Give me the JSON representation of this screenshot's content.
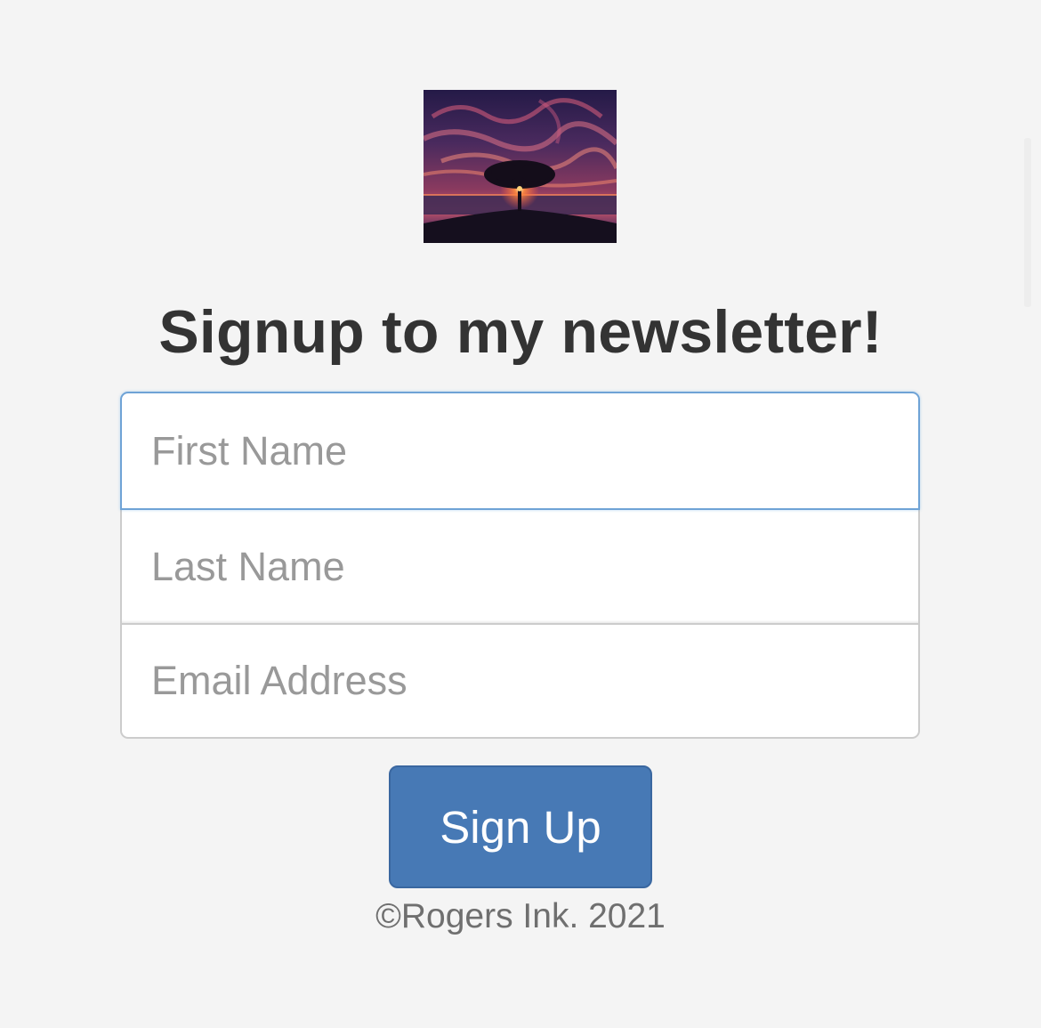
{
  "logo": {
    "alt": "Tree at sunset"
  },
  "heading": "Signup to my newsletter!",
  "form": {
    "first_name": {
      "value": "",
      "placeholder": "First Name"
    },
    "last_name": {
      "value": "",
      "placeholder": "Last Name"
    },
    "email": {
      "value": "",
      "placeholder": "Email Address"
    },
    "submit_label": "Sign Up"
  },
  "footer": {
    "copyright": "©Rogers Ink. 2021"
  },
  "colors": {
    "background": "#f4f4f4",
    "button": "#4779b5",
    "focus_border": "#6fa3d6",
    "heading": "#333333"
  }
}
